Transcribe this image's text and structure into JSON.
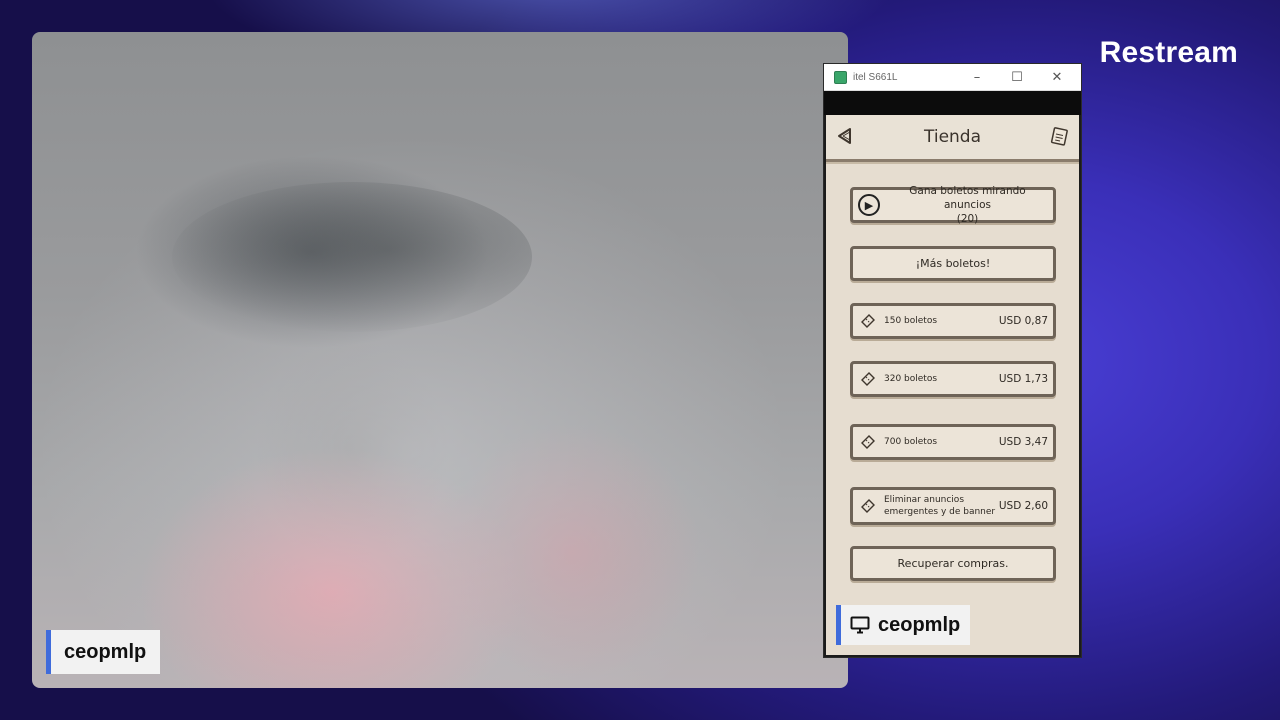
{
  "brand": "Restream",
  "camera": {
    "streamer_name": "ceopmlp"
  },
  "window": {
    "title": "itel S661L",
    "minimize_glyph": "–",
    "maximize_glyph": "☐",
    "close_glyph": "✕"
  },
  "app": {
    "header_title": "Tienda",
    "back_icon": "back-arrow-icon",
    "note_icon": "tickets-note-icon",
    "watch_ads": {
      "label": "Gana boletos mirando anuncios",
      "count": "(20)"
    },
    "more_tickets": "¡Más boletos!",
    "products": [
      {
        "label": "150 boletos",
        "price": "USD 0,87"
      },
      {
        "label": "320 boletos",
        "price": "USD 1,73"
      },
      {
        "label": "700 boletos",
        "price": "USD 3,47"
      },
      {
        "label": "Eliminar anuncios emergentes y de banner",
        "price": "USD 2,60"
      }
    ],
    "restore": "Recuperar compras."
  },
  "screen_share": {
    "name": "ceopmlp"
  },
  "colors": {
    "accent": "#3f6bdb",
    "background": "#3a2fb8",
    "app_bg": "#e6ddd0"
  }
}
